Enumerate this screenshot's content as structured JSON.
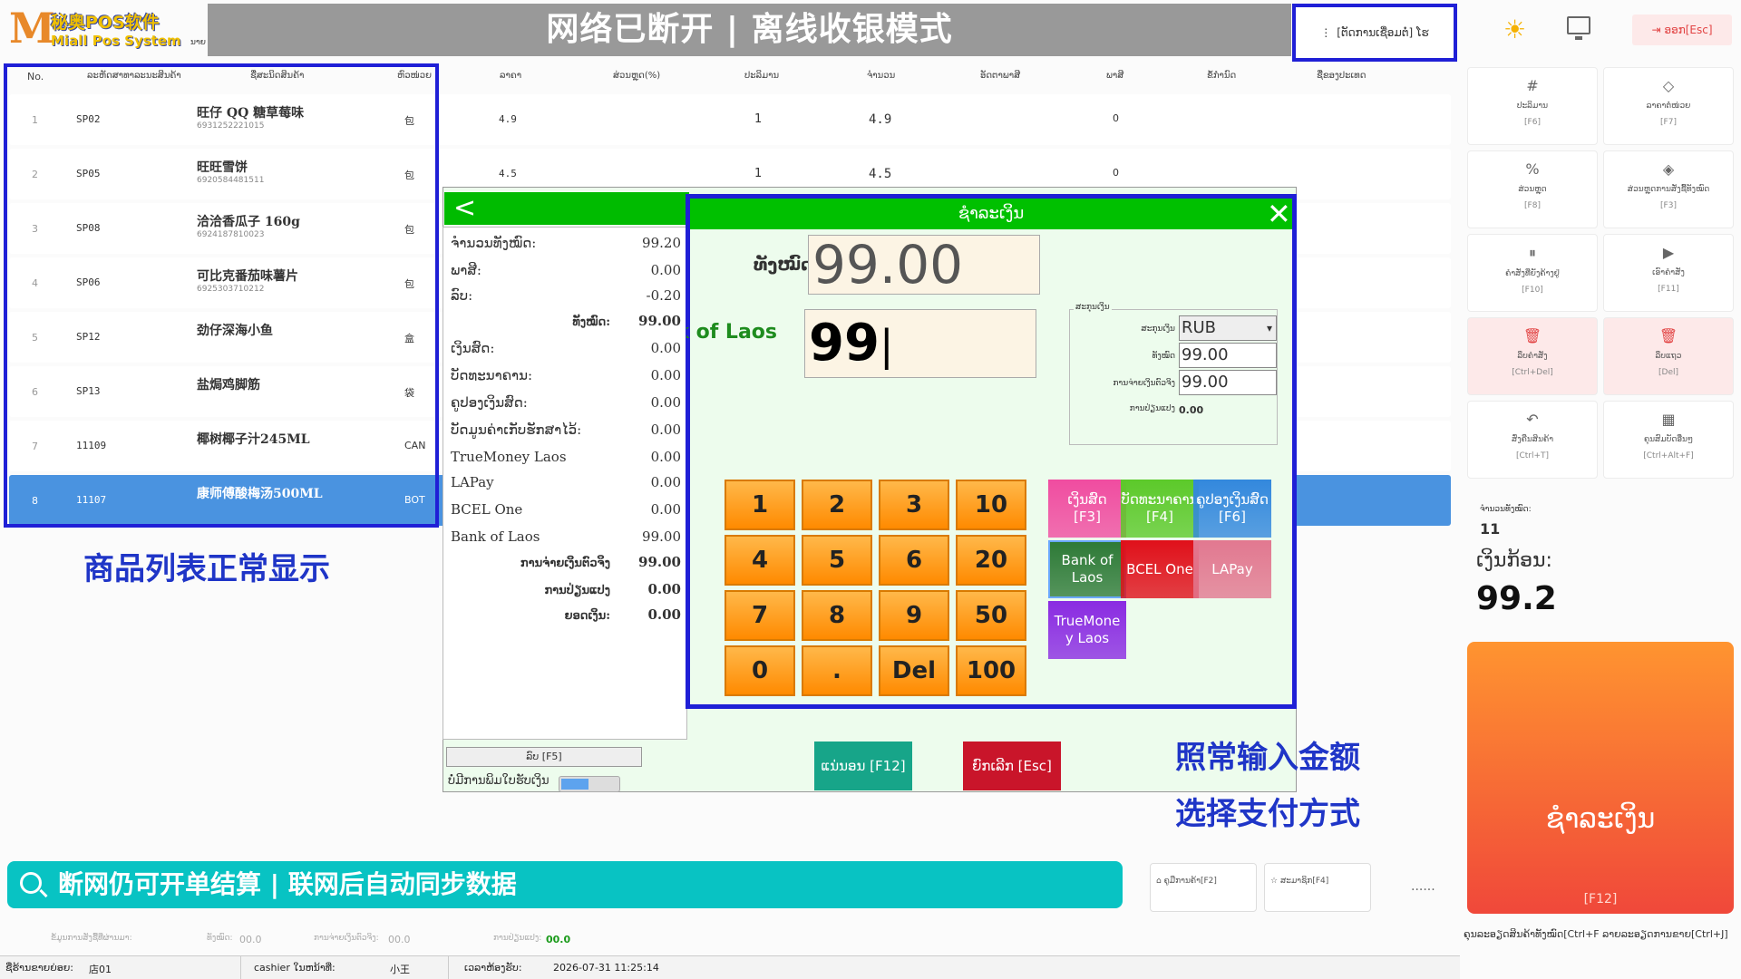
{
  "header": {
    "logo_mark": "M",
    "logo_cn": "秘奥POS软件",
    "logo_en": "Miall Pos System",
    "logo_tail": "ນາຍ",
    "banner": "网络已断开 | 离线收银模式",
    "net_status": "[ຕັດການເຊື່ອມຕໍ່] ໂຮ",
    "logout_label": "ອອກ[Esc]"
  },
  "table": {
    "headers": [
      "No.",
      "ລະຫັດສາທາລະນະສິນຄ້າ",
      "ຊື່ສະນິດສິນຄ້າ",
      "ຫົວໜ່ວຍ",
      "ລາຄາ",
      "ສ່ວນຫຼຸດ(%)",
      "ປະລິມານ",
      "ຈຳນວນ",
      "ອັດຕາພາສີ",
      "ພາສີ",
      "ຂໍ້ກຳນົດ",
      "ຊື່ຂອງປະເທດ"
    ],
    "rows": [
      {
        "no": "1",
        "code": "SP02",
        "name": "旺仔 QQ 糖草莓味",
        "barcode": "6931252221015",
        "unit": "包",
        "price": "4.9",
        "qty": "1",
        "amount": "4.9",
        "tax": "0"
      },
      {
        "no": "2",
        "code": "SP05",
        "name": "旺旺雪饼",
        "barcode": "6920584481511",
        "unit": "包",
        "price": "4.5",
        "qty": "1",
        "amount": "4.5",
        "tax": "0"
      },
      {
        "no": "3",
        "code": "SP08",
        "name": "洽洽香瓜子 160g",
        "barcode": "6924187810023",
        "unit": "包",
        "price": "",
        "qty": "",
        "amount": "",
        "tax": ""
      },
      {
        "no": "4",
        "code": "SP06",
        "name": "可比克番茄味薯片",
        "barcode": "6925303710212",
        "unit": "包",
        "price": "",
        "qty": "",
        "amount": "",
        "tax": ""
      },
      {
        "no": "5",
        "code": "SP12",
        "name": "劲仔深海小鱼",
        "barcode": "",
        "unit": "盒",
        "price": "",
        "qty": "",
        "amount": "",
        "tax": ""
      },
      {
        "no": "6",
        "code": "SP13",
        "name": "盐焗鸡脚筋",
        "barcode": "",
        "unit": "袋",
        "price": "",
        "qty": "",
        "amount": "",
        "tax": ""
      },
      {
        "no": "7",
        "code": "11109",
        "name": "椰树椰子汁245ML",
        "barcode": "",
        "unit": "CAN",
        "price": "",
        "qty": "",
        "amount": "",
        "tax": ""
      },
      {
        "no": "8",
        "code": "11107",
        "name": "康师傅酸梅汤500ML",
        "barcode": "",
        "unit": "BOT",
        "price": "",
        "qty": "",
        "amount": "",
        "tax": ""
      }
    ],
    "note": "商品列表正常显示"
  },
  "summary": {
    "lines": [
      {
        "label": "ຈຳນວນທັງໝົດ:",
        "value": "99.20"
      },
      {
        "label": "ພາສີ:",
        "value": "0.00"
      },
      {
        "label": "ລົບ:",
        "value": "-0.20"
      },
      {
        "label": "ທັງໝົດ:",
        "value": "99.00"
      },
      {
        "label": "ເງິນສົດ:",
        "value": "0.00"
      },
      {
        "label": "ບັດທະນາຄານ:",
        "value": "0.00"
      },
      {
        "label": "ຄູປອງເງິນສົດ:",
        "value": "0.00"
      },
      {
        "label": "ບັດມູນຄ່າເກັບຮັກສາໄວ້:",
        "value": "0.00"
      },
      {
        "label": "TrueMoney Laos",
        "value": "0.00"
      },
      {
        "label": "LAPay",
        "value": "0.00"
      },
      {
        "label": "BCEL One",
        "value": "0.00"
      },
      {
        "label": "Bank of Laos",
        "value": "99.00"
      },
      {
        "label": "ການຈ່າຍເງິນຕົວຈິງ",
        "value": "99.00"
      },
      {
        "label": "ການປ່ຽນແປງ",
        "value": "0.00"
      },
      {
        "label": "ຍອດເງິນ:",
        "value": "0.00"
      }
    ],
    "discount_button": "ລົບ [F5]",
    "no_print": "ບໍ່ມີການພິມໃບຮັບເງິນ"
  },
  "dialog": {
    "title": "ຊຳລະເງິນ",
    "total_label": "ທັງໝົດ",
    "total_value": "99.00",
    "pay_label": "nk of Laos",
    "pay_value": "99",
    "currency_group": "ສະກຸນເງິນ",
    "currency_label": "ສະກຸນເງິນ",
    "currency_value": "RUB",
    "cur_total_label": "ທັງໝົດ",
    "cur_total_value": "99.00",
    "cur_paid_label": "ການຈ່າຍເງິນຕົວຈິງ",
    "cur_paid_value": "99.00",
    "cur_change_label": "ການປ່ຽນແປງ",
    "cur_change_value": "0.00",
    "keys": [
      "1",
      "2",
      "3",
      "10",
      "4",
      "5",
      "6",
      "20",
      "7",
      "8",
      "9",
      "50",
      "0",
      ".",
      "Del",
      "100"
    ],
    "pay_methods": [
      {
        "label": "ເງິນສົດ\n[F3]",
        "color": "#f04ca0"
      },
      {
        "label": "ບັດທະນາຄານ\n[F4]",
        "color": "#5cc92a"
      },
      {
        "label": "ຄູປອງເງິນສົດ\n[F6]",
        "color": "#3388dd"
      },
      {
        "label": "Bank of\nLaos",
        "color": "#2e7a37"
      },
      {
        "label": "BCEL One",
        "color": "#e0101a"
      },
      {
        "label": "LAPay",
        "color": "#e27890"
      },
      {
        "label": "TrueMone\ny Laos",
        "color": "#8a2be2"
      }
    ],
    "confirm_button": "ແນ່ນອນ [F12]",
    "cancel_button": "ຍົກເລີກ [Esc]",
    "note1": "照常输入金额",
    "note2": "选择支付方式"
  },
  "right": {
    "buttons": [
      {
        "icon": "#",
        "label": "ປະລິມານ",
        "key": "[F6]",
        "red": false
      },
      {
        "icon": "◇",
        "label": "ລາຄາຕໍ່ໜ່ວຍ",
        "key": "[F7]",
        "red": false
      },
      {
        "icon": "%",
        "label": "ສ່ວນຫຼຸດ",
        "key": "[F8]",
        "red": false
      },
      {
        "icon": "◈",
        "label": "ສ່ວນຫຼຸດການສັ່ງຊື້ທັງໝົດ",
        "key": "[F3]",
        "red": false
      },
      {
        "icon": "⏸",
        "label": "ຄຳສັ່ງທີ່ຍັງຄ້າງຢູ່",
        "key": "[F10]",
        "red": false
      },
      {
        "icon": "▶",
        "label": "ເອົາຄຳສັ່ງ",
        "key": "[F11]",
        "red": false
      },
      {
        "icon": "🗑",
        "label": "ລຶບຄຳສັ່ງ",
        "key": "[Ctrl+Del]",
        "red": true
      },
      {
        "icon": "🗑",
        "label": "ລຶບແຖວ",
        "key": "[Del]",
        "red": true
      },
      {
        "icon": "↶",
        "label": "ສົ່ງຄືນສິນຄ້າ",
        "key": "[Ctrl+T]",
        "red": false
      },
      {
        "icon": "▦",
        "label": "ຄຸນສົມບັດອື່ນໆ",
        "key": "[Ctrl+Alt+F]",
        "red": false
      }
    ],
    "count_label": "ຈຳນວນທັງໝົດ:",
    "count_value": "11",
    "total_label": "ເງິນກ້ອນ:",
    "total_value": "99.2",
    "checkout_label": "ຊຳລະເງິນ",
    "checkout_key": "[F12]",
    "hint": "ຄຸນລະອຽດສິນຄ້າທັງໝົດ[Ctrl+F ລາຍລະອຽດການຂາຍ[Ctrl+J]"
  },
  "bottom": {
    "search_text": "断网仍可开单结算 | 联网后自动同步数据",
    "f2_label": "ຄູມືການຄ້າ[F2]",
    "f4_label": "ສະມາຊິກ[F4]",
    "dots": "......",
    "stats": [
      {
        "label": "ຂໍ້ມູນການສັ່ງຊື້ທີ່ຜ່ານມາ:",
        "value": ""
      },
      {
        "label": "ທັງໝົດ:",
        "value": "00.0"
      },
      {
        "label": "ການຈ່າຍເງິນຕົວຈິງ:",
        "value": "00.0"
      },
      {
        "label": "ການປ່ຽນແປງ:",
        "value": "00.0"
      }
    ]
  },
  "status": {
    "store_label": "ຊື່ຮ້ານຂາຍຍ່ອຍ:",
    "store_value": "店01",
    "cashier_label": "cashier ໃນຫນ້າທີ່:",
    "cashier_value": "小王",
    "time_label": "ເວລາຫ້ອງຮັບ:",
    "time_value": "2026-07-31 11:25:14"
  },
  "colors": {
    "accent": "#1f1fd6",
    "green": "#00c000",
    "teal": "#08c3c3",
    "orange": "#ff9c1c",
    "checkout": "#f0483a"
  }
}
